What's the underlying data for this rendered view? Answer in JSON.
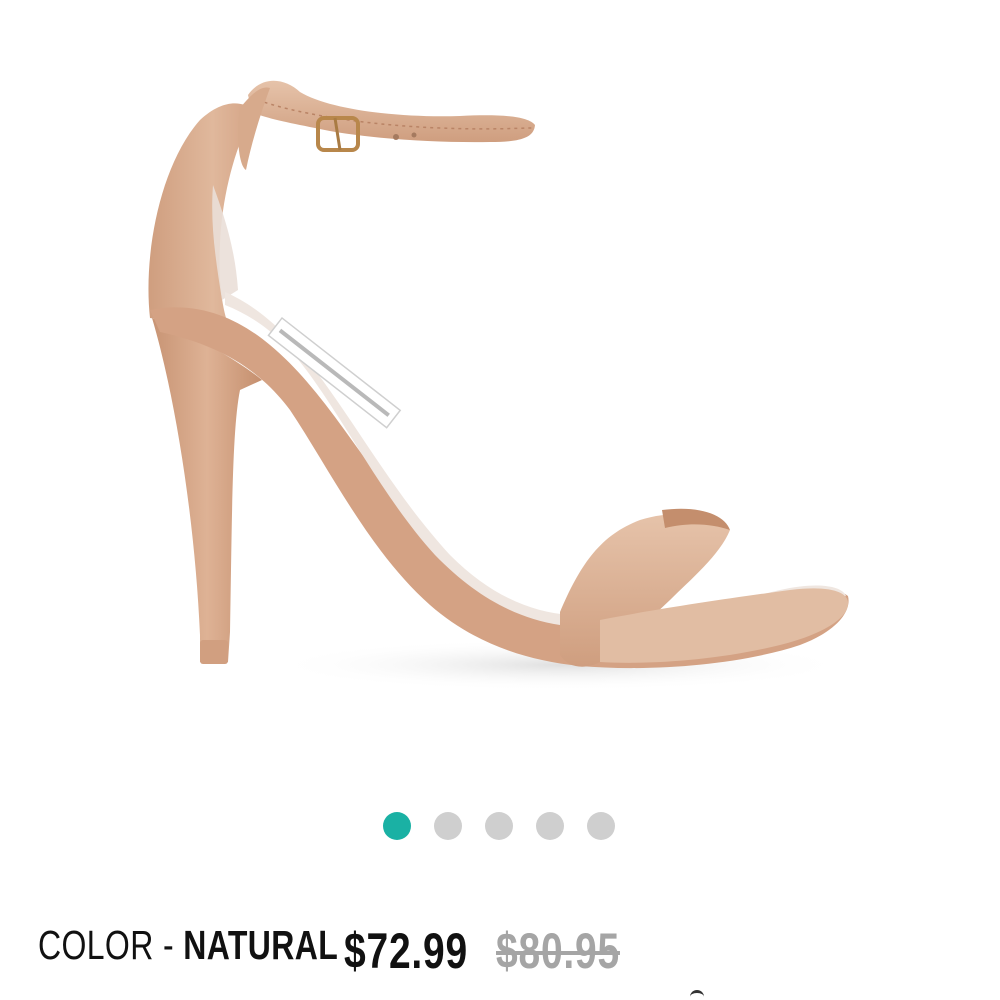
{
  "product": {
    "image_alt": "Nude leather ankle-strap stiletto sandal",
    "color_prefix": "COLOR - ",
    "color_name": "NATURAL",
    "price": "$72.99",
    "original_price": "$80.95",
    "colors": {
      "leather": "#d9ab8c",
      "leather_dark": "#c8916f",
      "lining": "#e9e1dc",
      "accent_teal": "#1ab1a4",
      "dot_inactive": "#cfcfcf",
      "strike_gray": "#a5a5a5"
    }
  },
  "carousel": {
    "total": 5,
    "active_index": 1
  }
}
